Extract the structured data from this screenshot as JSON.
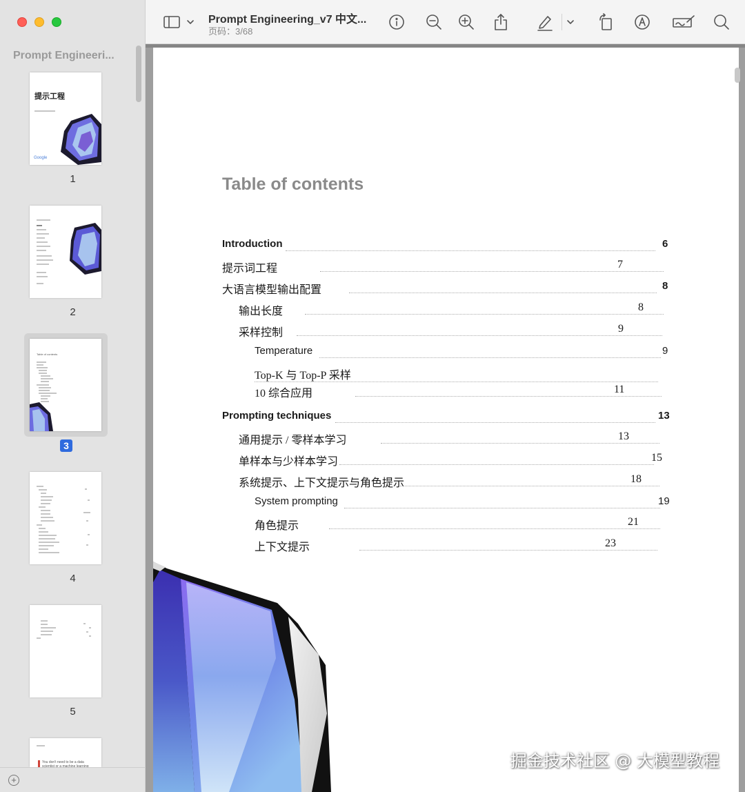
{
  "sidebar": {
    "title": "Prompt Engineeri...",
    "pages": [
      {
        "label": "1",
        "cover_title": "提示工程",
        "cover_brand": "Google"
      },
      {
        "label": "2"
      },
      {
        "label": "3",
        "mini_heading": "Table of contents"
      },
      {
        "label": "4"
      },
      {
        "label": "5"
      },
      {
        "label": "",
        "mini_text": "You don't need to be a data scientist or a machine learning engineer"
      }
    ],
    "selected_page": "3"
  },
  "toolbar": {
    "doc_title": "Prompt Engineering_v7 中文...",
    "page_info": "页码：3/68"
  },
  "toc": {
    "heading": "Table of contents",
    "entries": [
      {
        "label": "Introduction",
        "page": "6"
      },
      {
        "label": "提示词工程",
        "page": "7"
      },
      {
        "label": "大语言模型输出配置",
        "page": "8"
      },
      {
        "label": "输出长度",
        "page": "8"
      },
      {
        "label": "采样控制",
        "page": "9"
      },
      {
        "label": "Temperature",
        "page": "9"
      },
      {
        "label": "Top-K 与 Top-P 采样",
        "page": ""
      },
      {
        "label": "10 综合应用",
        "page": "11"
      },
      {
        "label": "Prompting techniques",
        "page": "13"
      },
      {
        "label": "通用提示 / 零样本学习",
        "page": "13"
      },
      {
        "label": "单样本与少样本学习",
        "page": "15"
      },
      {
        "label": "系统提示、上下文提示与角色提示",
        "page": "18"
      },
      {
        "label": "System prompting",
        "page": "19"
      },
      {
        "label": "角色提示",
        "page": "21"
      },
      {
        "label": "上下文提示",
        "page": "23"
      }
    ]
  },
  "watermark": "掘金技术社区 @ 大模型教程"
}
